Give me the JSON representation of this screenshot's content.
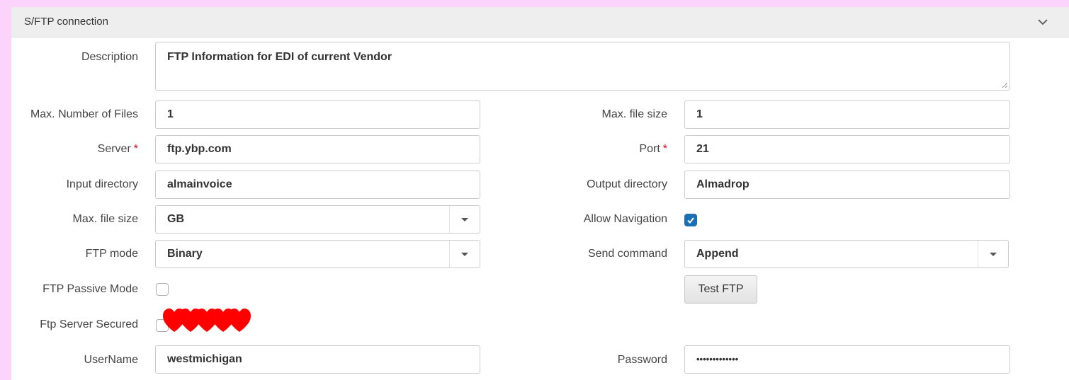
{
  "panel": {
    "title": "S/FTP connection",
    "collapse_icon": "chevron-down-icon"
  },
  "form": {
    "description": {
      "label": "Description",
      "value": "FTP Information for EDI of current Vendor"
    },
    "max_number_of_files": {
      "label": "Max. Number of Files",
      "value": "1"
    },
    "max_file_size_number": {
      "label": "Max. file size",
      "value": "1"
    },
    "server": {
      "label": "Server",
      "value": "ftp.ybp.com",
      "required_mark": "*"
    },
    "port": {
      "label": "Port",
      "value": "21",
      "required_mark": "*"
    },
    "input_directory": {
      "label": "Input directory",
      "value": "almainvoice"
    },
    "output_directory": {
      "label": "Output directory",
      "value": "Almadrop"
    },
    "max_file_size_unit": {
      "label": "Max. file size",
      "selected": "GB"
    },
    "allow_navigation": {
      "label": "Allow Navigation",
      "checked": true
    },
    "ftp_mode": {
      "label": "FTP mode",
      "selected": "Binary"
    },
    "send_command": {
      "label": "Send command",
      "selected": "Append"
    },
    "ftp_passive_mode": {
      "label": "FTP Passive Mode",
      "checked": false
    },
    "test_ftp": {
      "label": "Test FTP"
    },
    "ftp_server_secured": {
      "label": "Ftp Server Secured",
      "checked": false
    },
    "username": {
      "label": "UserName",
      "value": "westmichigan"
    },
    "password": {
      "label": "Password",
      "value": "•••••••••••••"
    }
  },
  "colors": {
    "page_background": "#fbd3fb",
    "header_background": "#eeeeee",
    "required": "#d0021b",
    "checkbox_checked": "#1b6fb3",
    "hearts": "#ff0000"
  },
  "overlay": {
    "icon": "heart-icon",
    "count": 5
  }
}
